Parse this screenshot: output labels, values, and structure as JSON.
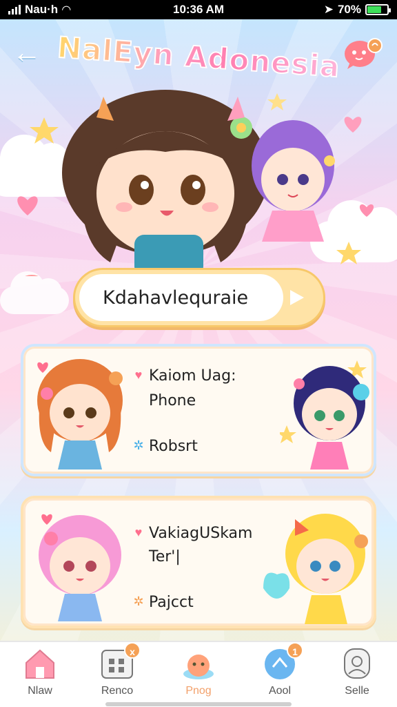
{
  "status_bar": {
    "carrier": "Nau·h",
    "time": "10:36 AM",
    "battery": "70%",
    "battery_level": 0.7
  },
  "header": {
    "back_icon": "arrow-left-icon",
    "title": "NalEyn Adonesia",
    "chat_icon": "chat-bubble-icon"
  },
  "hero": {
    "image": "chibi-girls-illustration"
  },
  "pill": {
    "label": "Kdahavlequraie",
    "play_icon": "play-triangle-icon"
  },
  "cards": [
    {
      "line1": "Kaiom Uag:",
      "line2": "Phone",
      "line3": "Robsrt",
      "icon1": "heart-icon",
      "icon3": "sparkle-icon"
    },
    {
      "line1": "VakiagUSkam",
      "line2": "Ter'|",
      "line3": "Pajcct",
      "icon1": "heart-icon",
      "icon3": "sparkle-icon"
    }
  ],
  "bottom_nav": [
    {
      "label": "Nlaw",
      "icon": "home-icon",
      "badge": ""
    },
    {
      "label": "Renco",
      "icon": "grid-icon",
      "badge": "x"
    },
    {
      "label": "Pnog",
      "icon": "blob-icon",
      "badge": "",
      "active": true
    },
    {
      "label": "Aool",
      "icon": "chat-icon",
      "badge": "1"
    },
    {
      "label": "Selle",
      "icon": "profile-icon",
      "badge": ""
    }
  ],
  "colors": {
    "accent": "#f5a156",
    "pill_border": "#f7c86a",
    "card_bg": "#fffaf2",
    "heart": "#ff6f8e"
  }
}
